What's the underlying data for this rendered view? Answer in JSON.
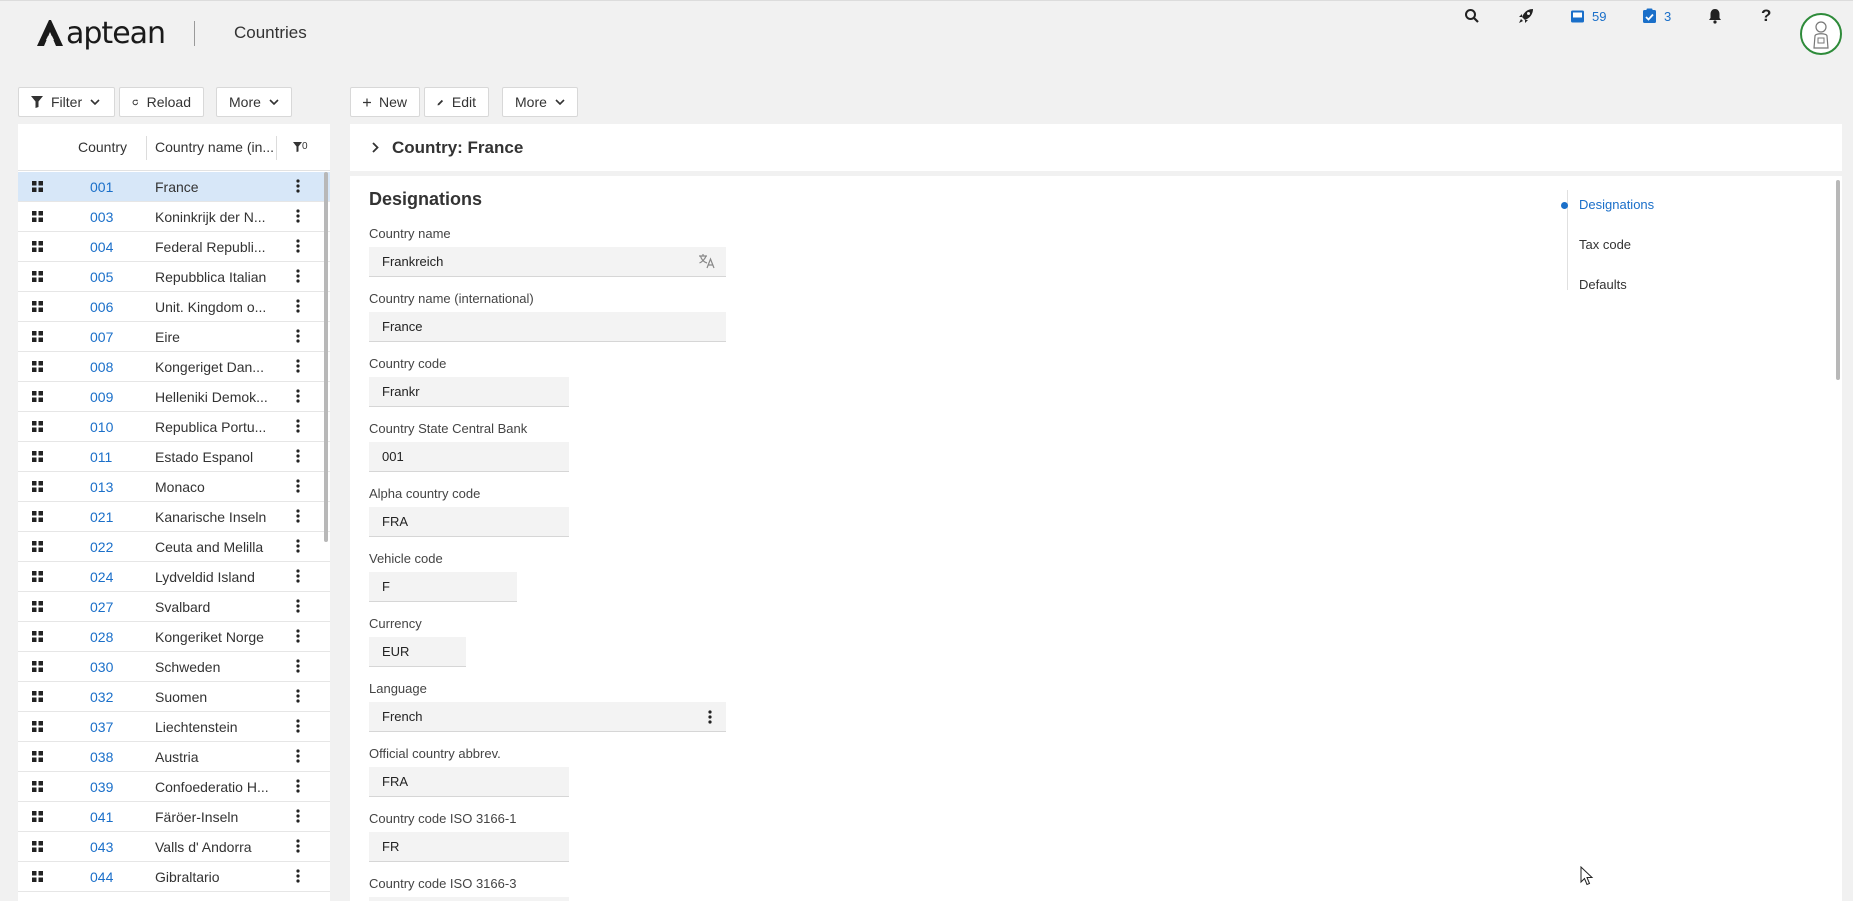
{
  "app": {
    "brand": "aptean",
    "title": "Countries"
  },
  "header": {
    "inbox_count": "59",
    "tasks_count": "3"
  },
  "list_toolbar": {
    "filter_label": "Filter",
    "reload_label": "Reload",
    "more_label": "More"
  },
  "detail_toolbar": {
    "new_label": "New",
    "edit_label": "Edit",
    "more_label": "More"
  },
  "list": {
    "col_country": "Country",
    "col_name": "Country name (in...",
    "filter_count": "0",
    "rows": [
      {
        "code": "001",
        "name": "France"
      },
      {
        "code": "003",
        "name": "Koninkrijk der N..."
      },
      {
        "code": "004",
        "name": "Federal Republi..."
      },
      {
        "code": "005",
        "name": "Repubblica Italian"
      },
      {
        "code": "006",
        "name": "Unit. Kingdom o..."
      },
      {
        "code": "007",
        "name": "Eire"
      },
      {
        "code": "008",
        "name": "Kongeriget Dan..."
      },
      {
        "code": "009",
        "name": "Helleniki Demok..."
      },
      {
        "code": "010",
        "name": "Republica Portu..."
      },
      {
        "code": "011",
        "name": "Estado Espanol"
      },
      {
        "code": "013",
        "name": "Monaco"
      },
      {
        "code": "021",
        "name": "Kanarische Inseln"
      },
      {
        "code": "022",
        "name": "Ceuta and Melilla"
      },
      {
        "code": "024",
        "name": "Lydveldid Island"
      },
      {
        "code": "027",
        "name": "Svalbard"
      },
      {
        "code": "028",
        "name": "Kongeriket Norge"
      },
      {
        "code": "030",
        "name": "Schweden"
      },
      {
        "code": "032",
        "name": "Suomen"
      },
      {
        "code": "037",
        "name": "Liechtenstein"
      },
      {
        "code": "038",
        "name": "Austria"
      },
      {
        "code": "039",
        "name": "Confoederatio H..."
      },
      {
        "code": "041",
        "name": "Färöer-Inseln"
      },
      {
        "code": "043",
        "name": "Valls d' Andorra"
      },
      {
        "code": "044",
        "name": "Gibraltario"
      }
    ]
  },
  "detail": {
    "title": "Country: France",
    "section": "Designations",
    "fields": {
      "country_name": {
        "label": "Country name",
        "value": "Frankreich"
      },
      "country_name_intl": {
        "label": "Country name (international)",
        "value": "France"
      },
      "country_code": {
        "label": "Country code",
        "value": "Frankr"
      },
      "central_bank": {
        "label": "Country State Central Bank",
        "value": "001"
      },
      "alpha_code": {
        "label": "Alpha country code",
        "value": "FRA"
      },
      "vehicle_code": {
        "label": "Vehicle code",
        "value": "F"
      },
      "currency": {
        "label": "Currency",
        "value": "EUR"
      },
      "language": {
        "label": "Language",
        "value": "French"
      },
      "official_abbrev": {
        "label": "Official country abbrev.",
        "value": "FRA"
      },
      "iso_3166_1": {
        "label": "Country code ISO 3166-1",
        "value": "FR"
      },
      "iso_3166_3": {
        "label": "Country code ISO 3166-3",
        "value": ""
      }
    },
    "anchors": [
      "Designations",
      "Tax code",
      "Defaults"
    ]
  },
  "colors": {
    "accent": "#1a6fc9",
    "selected_row": "#d7e7f8",
    "avatar_ring": "#2e8b3a"
  }
}
